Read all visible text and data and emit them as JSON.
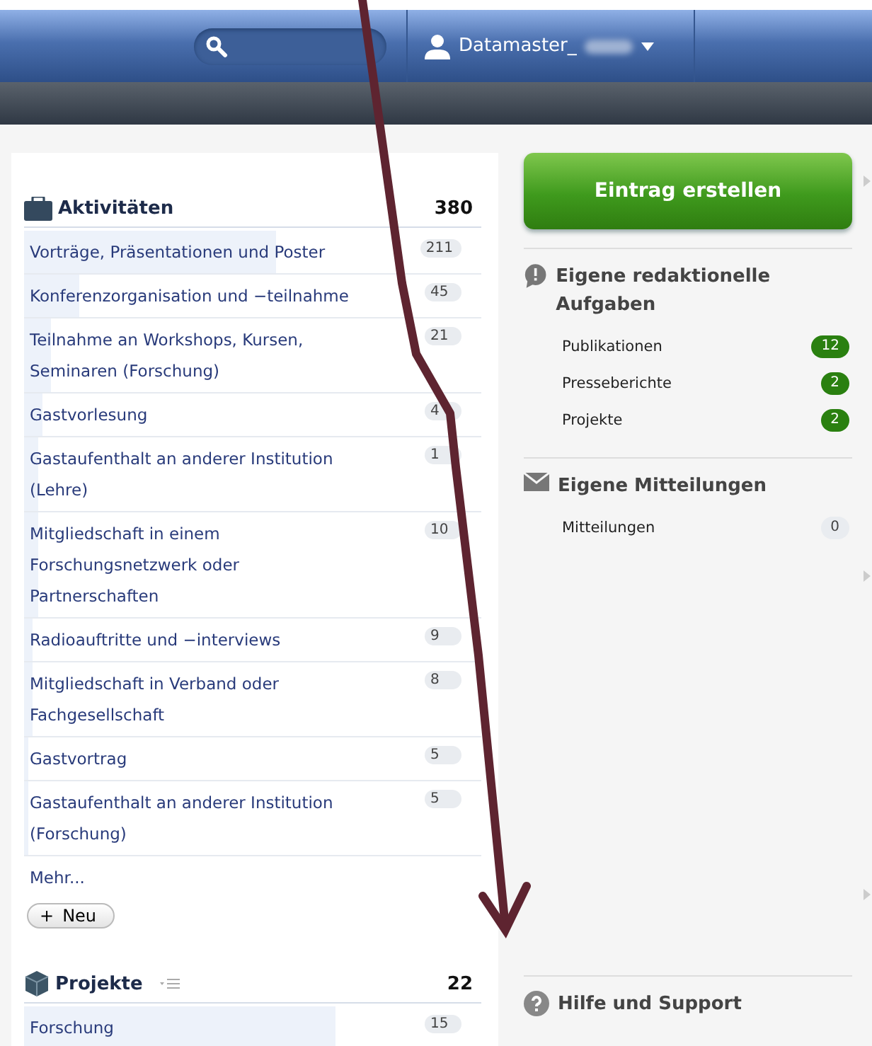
{
  "header": {
    "user": {
      "name": "Datamaster_"
    }
  },
  "activities": {
    "title": "Aktivitäten",
    "total": "380",
    "items": [
      {
        "label": "Vorträge, Präsentationen und Poster",
        "count": "211",
        "level": 0.55
      },
      {
        "label": "Konferenzorganisation und −teilnahme",
        "count": "45",
        "level": 0.12
      },
      {
        "label": "Teilnahme an Workshops, Kursen, Seminaren (Forschung)",
        "count": "21",
        "level": 0.06
      },
      {
        "label": "Gastvorlesung",
        "count": "4",
        "level": 0.04
      },
      {
        "label": "Gastaufenthalt an anderer Institution (Lehre)",
        "count": "1",
        "level": 0.03
      },
      {
        "label": "Mitgliedschaft in einem Forschungsnetzwerk oder Partnerschaften",
        "count": "10",
        "level": 0.03
      },
      {
        "label": "Radioauftritte und −interviews",
        "count": "9",
        "level": 0.02
      },
      {
        "label": "Mitgliedschaft in Verband oder Fachgesellschaft",
        "count": "8",
        "level": 0.02
      },
      {
        "label": "Gastvortrag",
        "count": "5",
        "level": 0.01
      },
      {
        "label": "Gastaufenthalt an anderer Institution (Forschung)",
        "count": "5",
        "level": 0.01
      }
    ],
    "more": "Mehr...",
    "new_button": {
      "icon": "+",
      "label": "Neu"
    }
  },
  "projects": {
    "title": "Projekte",
    "total": "22",
    "items": [
      {
        "label": "Forschung",
        "count": "15",
        "level": 0.68
      }
    ]
  },
  "sidebar": {
    "create_button": "Eintrag erstellen",
    "sections": [
      {
        "kind": "tasks",
        "title": "Eigene redaktionelle Aufgaben",
        "items": [
          {
            "label": "Publikationen",
            "count": "12",
            "highlighted": true
          },
          {
            "label": "Presseberichte",
            "count": "2",
            "highlighted": true
          },
          {
            "label": "Projekte",
            "count": "2",
            "highlighted": true
          }
        ]
      },
      {
        "kind": "messages",
        "title": "Eigene Mitteilungen",
        "items": [
          {
            "label": "Mitteilungen",
            "count": "0",
            "highlighted": false
          }
        ]
      },
      {
        "kind": "help",
        "title": "Hilfe und Support"
      }
    ]
  }
}
